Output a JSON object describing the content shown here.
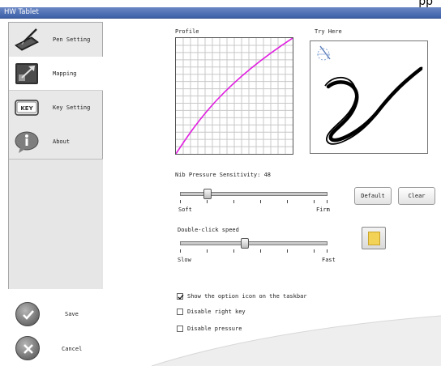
{
  "window": {
    "title": "HW Tablet",
    "top_glyph": "pp"
  },
  "sidebar": {
    "items": [
      {
        "label": "Pen Setting",
        "icon": "pen-tablet-icon"
      },
      {
        "label": "Mapping",
        "icon": "mapping-icon"
      },
      {
        "label": "Key Setting",
        "icon": "key-icon"
      },
      {
        "label": "About",
        "icon": "info-speech-icon"
      }
    ],
    "active_index": 1
  },
  "actions": {
    "save_label": "Save",
    "cancel_label": "Cancel"
  },
  "profile": {
    "label": "Profile"
  },
  "try_here": {
    "label": "Try Here"
  },
  "nib": {
    "label": "Nib Pressure Sensitivity: 48",
    "value": 48,
    "min_label": "Soft",
    "max_label": "Firm"
  },
  "double_click": {
    "label": "Double-click speed",
    "min_label": "Slow",
    "max_label": "Fast"
  },
  "buttons": {
    "default_label": "Default",
    "clear_label": "Clear"
  },
  "options": [
    {
      "label": "Show the option icon on the taskbar",
      "checked": true
    },
    {
      "label": "Disable right key",
      "checked": false
    },
    {
      "label": "Disable pressure",
      "checked": false
    }
  ],
  "colors": {
    "title_bar": "#3c5fa7",
    "curve": "#e020e0",
    "swatch": "#f2d257"
  }
}
